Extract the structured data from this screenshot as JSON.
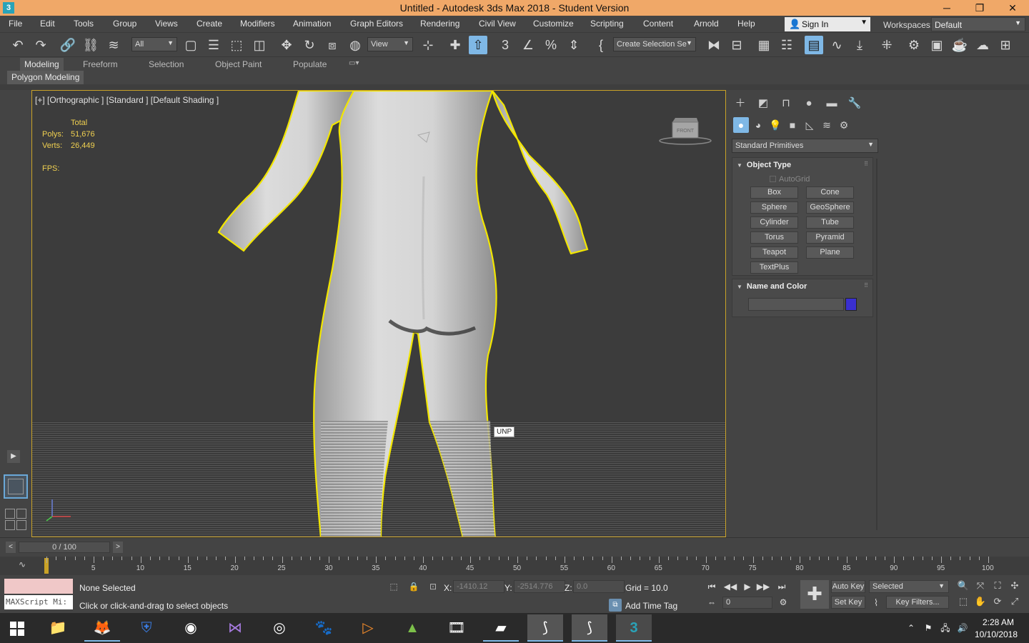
{
  "window": {
    "title": "Untitled - Autodesk 3ds Max 2018 - Student Version",
    "app_icon_text": "3",
    "minimize": "─",
    "restore": "❐",
    "close": "✕"
  },
  "menu": [
    "File",
    "Edit",
    "Tools",
    "Group",
    "Views",
    "Create",
    "Modifiers",
    "Animation",
    "Graph Editors",
    "Rendering",
    "Civil View",
    "Customize",
    "Scripting",
    "Content",
    "Arnold",
    "Help"
  ],
  "account": {
    "sign_in": "Sign In",
    "workspaces_label": "Workspaces:",
    "workspace": "Default"
  },
  "toolbar": {
    "filter_select": "All",
    "ref_coord_select": "View",
    "named_selection": "Create Selection Se"
  },
  "ribbon": {
    "tabs": [
      "Modeling",
      "Freeform",
      "Selection",
      "Object Paint",
      "Populate"
    ],
    "active_tab": "Modeling",
    "sub_tab": "Polygon Modeling"
  },
  "viewport": {
    "label": "[+] [Orthographic ] [Standard ] [Default Shading ]",
    "stats_header": "Total",
    "polys_label": "Polys:",
    "polys": "51,676",
    "verts_label": "Verts:",
    "verts": "26,449",
    "fps_label": "FPS:",
    "tooltip": "UNP",
    "viewcube_face": "FRONT"
  },
  "command_panel": {
    "category": "Standard Primitives",
    "object_type_title": "Object Type",
    "autogrid": "AutoGrid",
    "buttons": [
      "Box",
      "Cone",
      "Sphere",
      "GeoSphere",
      "Cylinder",
      "Tube",
      "Torus",
      "Pyramid",
      "Teapot",
      "Plane",
      "TextPlus"
    ],
    "name_color_title": "Name and Color",
    "object_color": "#3a2fd0"
  },
  "timeline": {
    "frame_display": "0 / 100",
    "ticks": [
      "5",
      "10",
      "15",
      "20",
      "25",
      "30",
      "35",
      "40",
      "45",
      "50",
      "55",
      "60",
      "65",
      "70",
      "75",
      "80",
      "85",
      "90",
      "95",
      "100"
    ]
  },
  "status": {
    "maxscript": "MAXScript Mi:",
    "selection": "None Selected",
    "prompt": "Click or click-and-drag to select objects",
    "x_label": "X:",
    "x_value": "-1410.12",
    "y_label": "Y:",
    "y_value": "-2514.776",
    "z_label": "Z:",
    "z_value": "0.0",
    "grid": "Grid = 10.0",
    "add_time_tag": "Add Time Tag",
    "current_frame": "0",
    "auto_key": "Auto Key",
    "set_key": "Set Key",
    "key_mode": "Selected",
    "key_filters": "Key Filters..."
  },
  "taskbar": {
    "time": "2:28 AM",
    "date": "10/10/2018"
  }
}
